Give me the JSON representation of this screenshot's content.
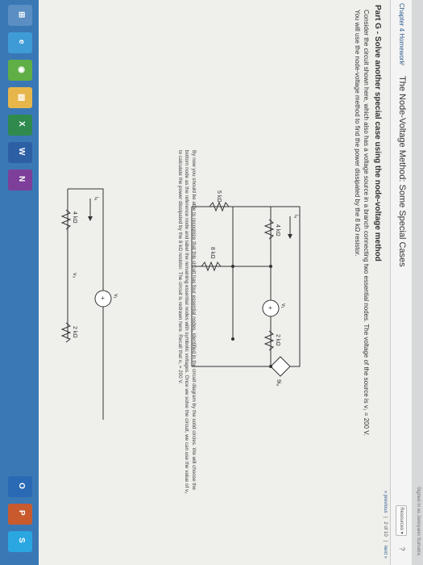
{
  "top_bar": {
    "signed_in": "Signed in as Jennyann Sumatra"
  },
  "breadcrumb": {
    "course": "Chapter 4 Homework",
    "current": "The Node-Voltage Method: Some Special Cases"
  },
  "toolbar": {
    "resources_label": "Resources",
    "help_icon": "help-icon"
  },
  "pager": {
    "previous": "« previous",
    "position": "2 of 10",
    "next": "next »"
  },
  "part": {
    "title": "Part G - Solve another special case using the node-voltage method",
    "intro_line1": "Consider the circuit shown here, which also has a voltage source in a branch connecting two essential nodes. The voltage of the source is v₁ = 200 V.",
    "intro_line2": "You will use the node-voltage method to find the power dissipated by the 8 kΩ resistor."
  },
  "circuit1": {
    "r1": "4 kΩ",
    "r2": "2 kΩ",
    "r3": "5 kΩ",
    "r4": "8 kΩ",
    "i_label": "iₐ",
    "v_label": "v₁",
    "dep_src": "9iₐ"
  },
  "paragraph": {
    "line1": "By now you should be able to recognize that this circuit has four essential nodes, identified in the circuit diagram by the solid circles. We will choose the",
    "line2": "bottom node as the reference node and label the remaining essential nodes with symbolic voltages. Once we solve the circuit, we can use the value of v₂",
    "line3": "to calculate the power dissipated by the 8 kΩ resistor. The circuit is redrawn here. Recall that v₁ = 200 V."
  },
  "circuit2": {
    "r1": "4 kΩ",
    "r2": "2 kΩ",
    "i_label": "iₐ",
    "v_label": "v₁",
    "v3": "v₃"
  },
  "taskbar": {
    "icons": [
      "windows-start-icon",
      "ie-icon",
      "chrome-icon",
      "file-explorer-icon",
      "excel-icon",
      "word-icon",
      "onenote-icon",
      "outlook-icon",
      "powerpoint-icon",
      "skype-icon"
    ]
  }
}
